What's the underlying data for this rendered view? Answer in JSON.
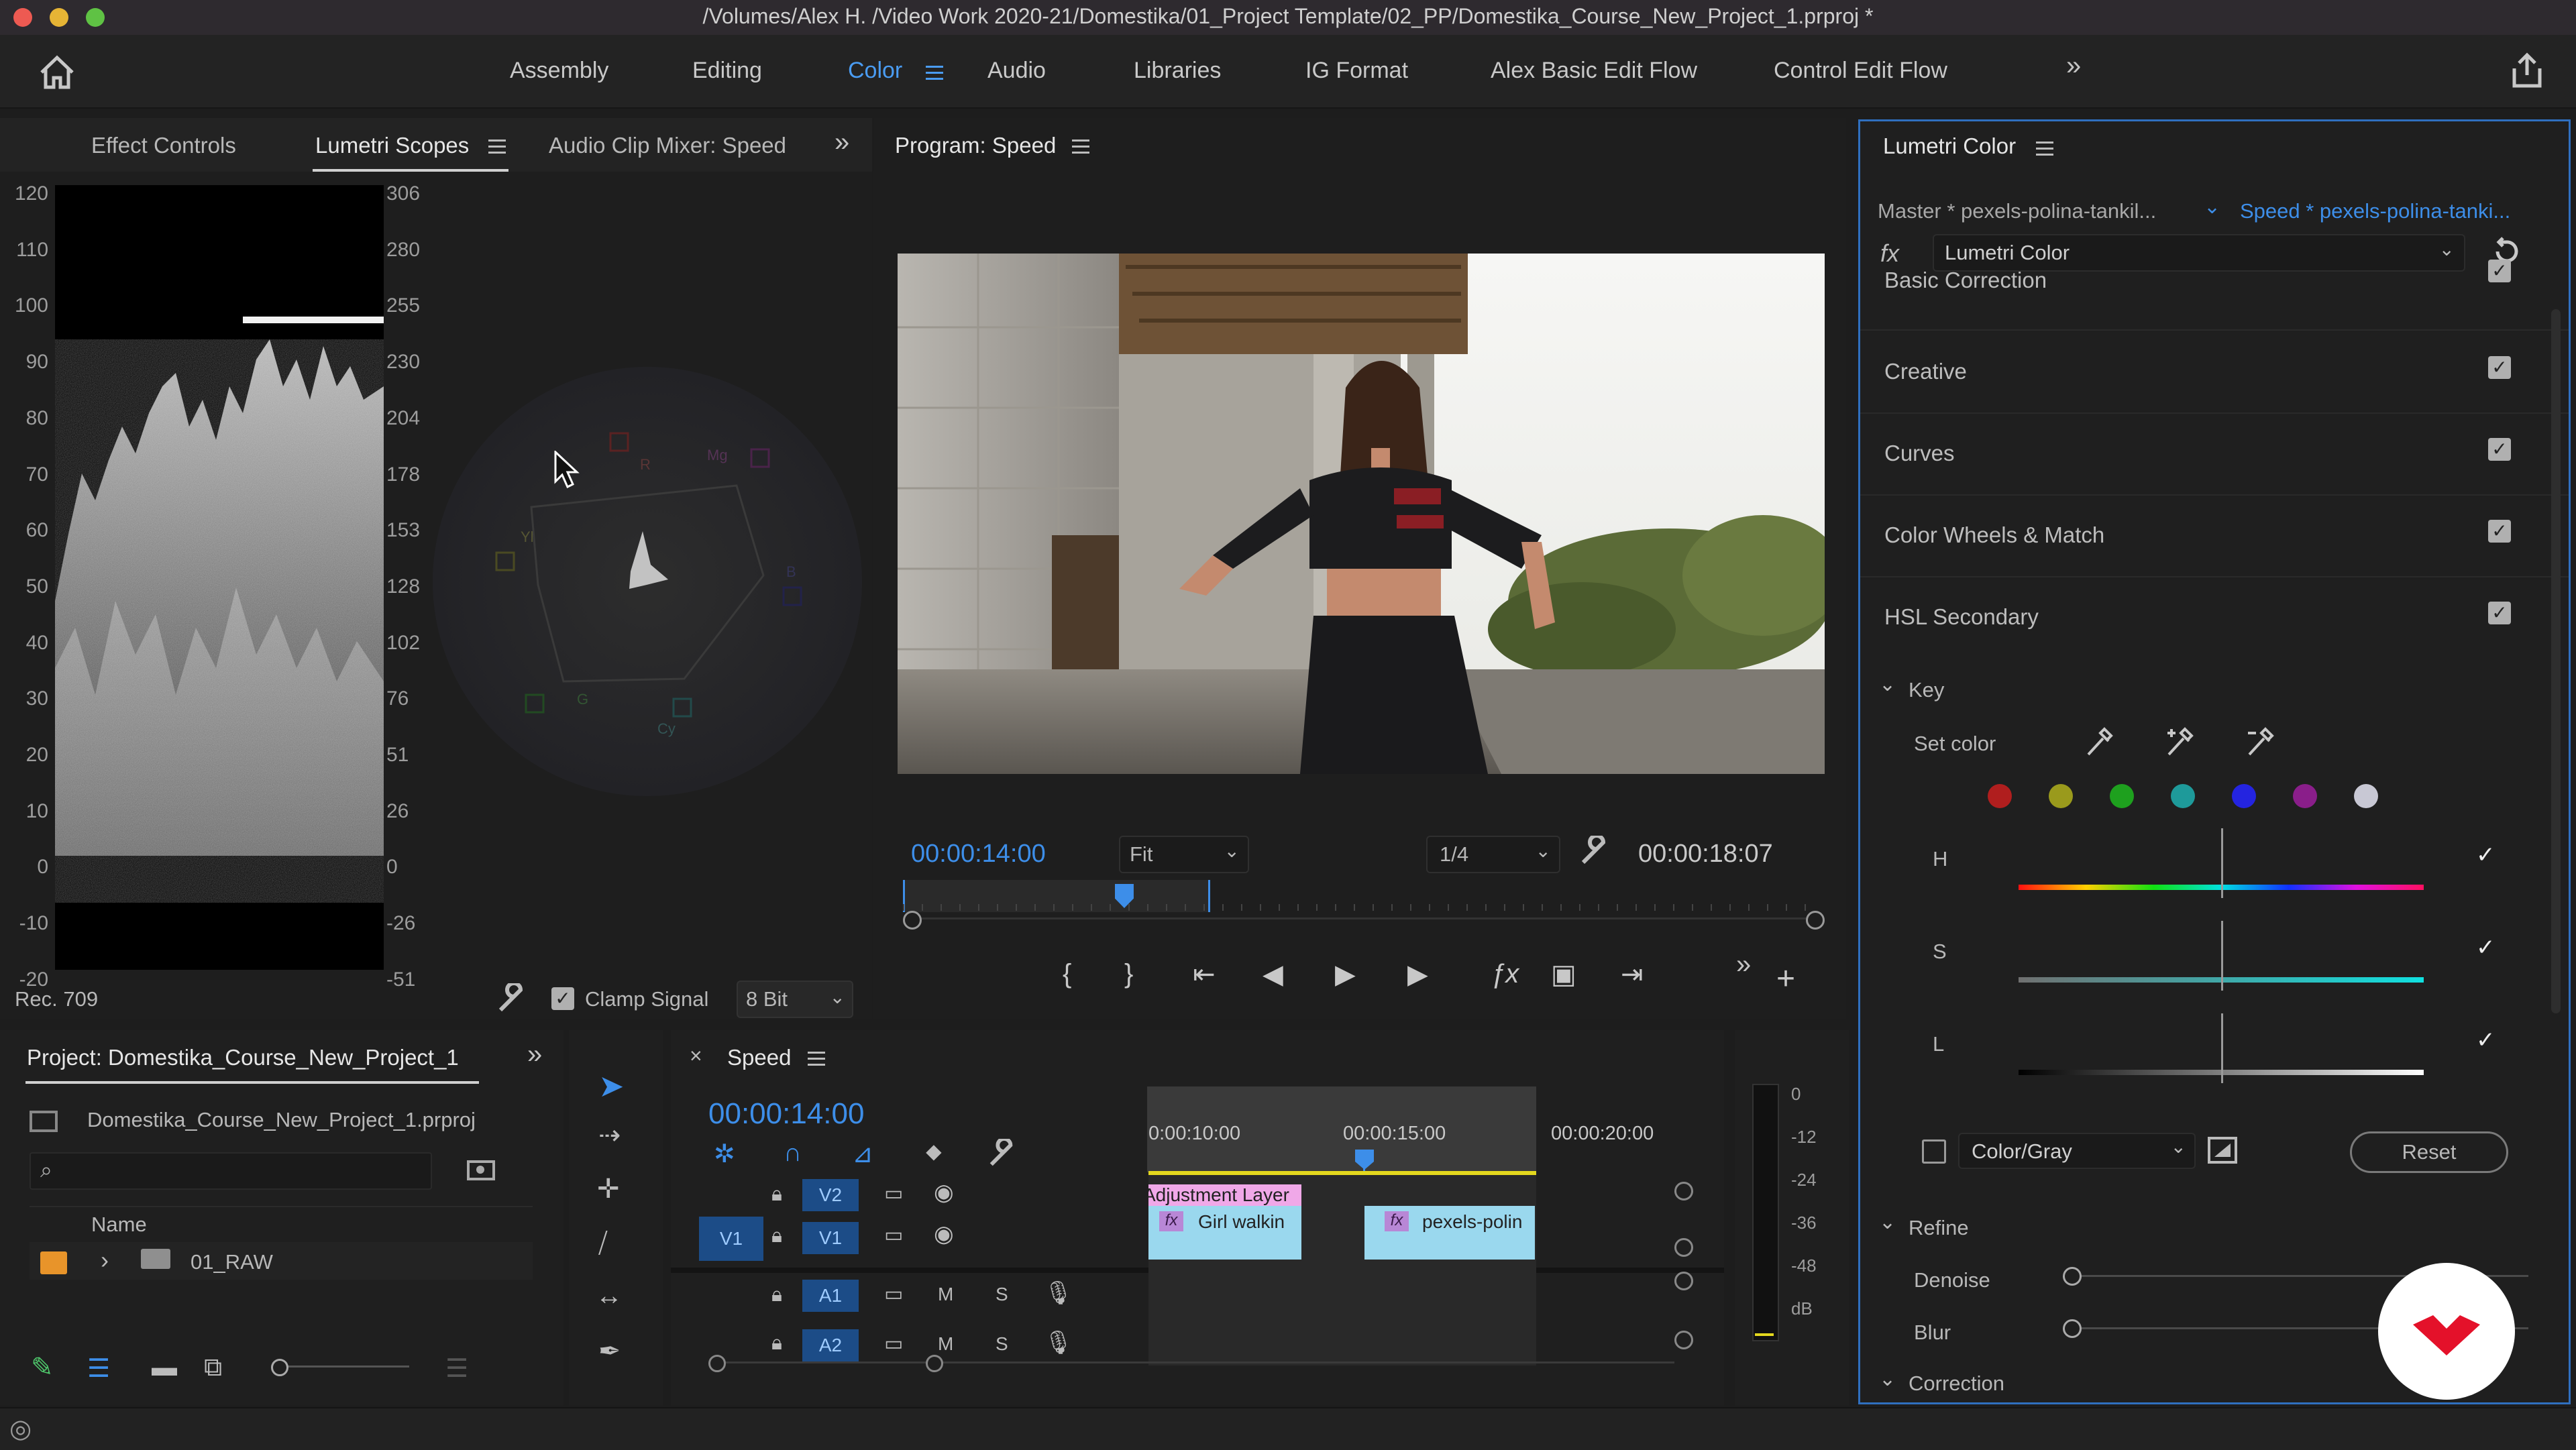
{
  "window": {
    "title": "/Volumes/Alex H. /Video Work 2020-21/Domestika/01_Project Template/02_PP/Domestika_Course_New_Project_1.prproj *"
  },
  "workspaces": {
    "tabs": [
      "Assembly",
      "Editing",
      "Color",
      "Audio",
      "Libraries",
      "IG Format",
      "Alex Basic Edit Flow",
      "Control Edit Flow"
    ],
    "active": "Color",
    "more": "»"
  },
  "scopes_panel": {
    "tabs": [
      "Effect Controls",
      "Lumetri Scopes",
      "Audio Clip Mixer: Speed"
    ],
    "active": "Lumetri Scopes",
    "left_scale": [
      "120",
      "110",
      "100",
      "90",
      "80",
      "70",
      "60",
      "50",
      "40",
      "30",
      "20",
      "10",
      "0",
      "-10",
      "-20"
    ],
    "right_scale": [
      "306",
      "280",
      "255",
      "230",
      "204",
      "178",
      "153",
      "128",
      "102",
      "76",
      "51",
      "26",
      "0",
      "-26",
      "-51"
    ],
    "vectorscope_labels": [
      "R",
      "Mg",
      "B",
      "Cy",
      "G",
      "Yl"
    ],
    "colorspace": "Rec. 709",
    "clamp_signal_label": "Clamp Signal",
    "clamp_signal_checked": true,
    "bit_depth": "8 Bit"
  },
  "program_monitor": {
    "title": "Program: Speed",
    "timecode_in": "00:00:14:00",
    "zoom": "Fit",
    "resolution": "1/4",
    "timecode_duration": "00:00:18:07",
    "playhead_progress": 0.73
  },
  "lumetri_color": {
    "title": "Lumetri Color",
    "master_label": "Master * pexels-polina-tankil...",
    "speed_label": "Speed * pexels-polina-tanki...",
    "fx_label": "fx",
    "effect": "Lumetri Color",
    "sections": [
      {
        "label": "Basic Correction",
        "checked": true
      },
      {
        "label": "Creative",
        "checked": true
      },
      {
        "label": "Curves",
        "checked": true
      },
      {
        "label": "Color Wheels & Match",
        "checked": true
      },
      {
        "label": "HSL Secondary",
        "checked": true
      }
    ],
    "key_label": "Key",
    "set_color_label": "Set color",
    "swatches": [
      "#b01e1e",
      "#9a9a1c",
      "#1ea01e",
      "#1e9a9a",
      "#2424e0",
      "#8a1e8a",
      "#c8c8d4"
    ],
    "hsl_labels": [
      "H",
      "S",
      "L"
    ],
    "display_mode": "Color/Gray",
    "reset_label": "Reset",
    "refine_label": "Refine",
    "denoise_label": "Denoise",
    "blur_label": "Blur",
    "correction_label": "Correction"
  },
  "project_panel": {
    "title": "Project: Domestika_Course_New_Project_1",
    "file": "Domestika_Course_New_Project_1.prproj",
    "search_placeholder": "",
    "column_name": "Name",
    "items": [
      {
        "label": "01_RAW"
      }
    ]
  },
  "timeline": {
    "sequence": "Speed",
    "timecode": "00:00:14:00",
    "ruler": [
      "0:00:10:00",
      "00:00:15:00",
      "00:00:20:00"
    ],
    "tracks": [
      "V2",
      "V1",
      "A1",
      "A2"
    ],
    "source_patch": "V1",
    "track_mute": "M",
    "track_solo": "S",
    "clips": {
      "adjustment": "Adjustment Layer",
      "girl": "Girl walkin",
      "pexels": "pexels-polin"
    },
    "fx_badge": "fx"
  },
  "audio_meter": {
    "scale": [
      "0",
      "-12",
      "-24",
      "-36",
      "-48",
      "dB"
    ]
  },
  "colors": {
    "accent_blue": "#3d8ee9",
    "clip_cyan": "#9ad8ee",
    "clip_pink": "#f0a8e8",
    "brand_red": "#e4112a"
  }
}
